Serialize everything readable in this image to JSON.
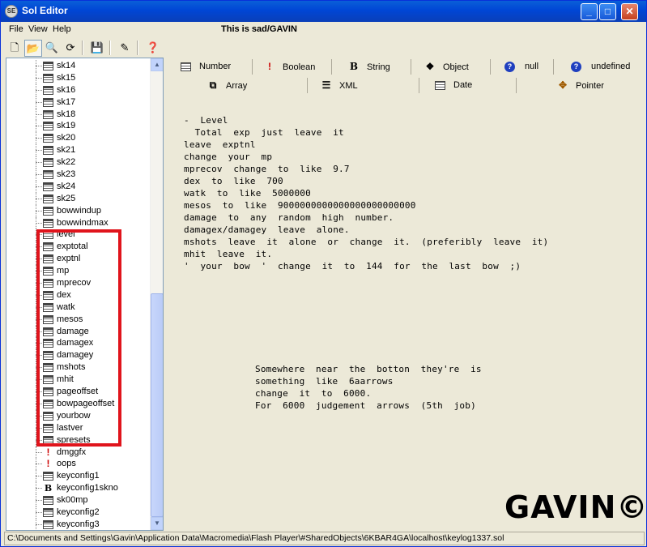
{
  "window": {
    "title": "Sol Editor",
    "app_icon_text": "SE"
  },
  "menu": {
    "file": "File",
    "view": "View",
    "help": "Help"
  },
  "header_caption": "This is sad/GAVIN",
  "toolbar": {
    "icons": [
      "new-icon",
      "open-folder-icon",
      "find-icon",
      "refresh-icon",
      "save-icon",
      "wand-icon",
      "help-icon"
    ]
  },
  "tree": {
    "items": [
      {
        "label": "sk14",
        "type": "number"
      },
      {
        "label": "sk15",
        "type": "number"
      },
      {
        "label": "sk16",
        "type": "number"
      },
      {
        "label": "sk17",
        "type": "number"
      },
      {
        "label": "sk18",
        "type": "number"
      },
      {
        "label": "sk19",
        "type": "number"
      },
      {
        "label": "sk20",
        "type": "number"
      },
      {
        "label": "sk21",
        "type": "number"
      },
      {
        "label": "sk22",
        "type": "number"
      },
      {
        "label": "sk23",
        "type": "number"
      },
      {
        "label": "sk24",
        "type": "number"
      },
      {
        "label": "sk25",
        "type": "number"
      },
      {
        "label": "bowwindup",
        "type": "number"
      },
      {
        "label": "bowwindmax",
        "type": "number"
      },
      {
        "label": "level",
        "type": "number"
      },
      {
        "label": "exptotal",
        "type": "number"
      },
      {
        "label": "exptnl",
        "type": "number"
      },
      {
        "label": "mp",
        "type": "number"
      },
      {
        "label": "mprecov",
        "type": "number"
      },
      {
        "label": "dex",
        "type": "number"
      },
      {
        "label": "watk",
        "type": "number"
      },
      {
        "label": "mesos",
        "type": "number"
      },
      {
        "label": "damage",
        "type": "number"
      },
      {
        "label": "damagex",
        "type": "number"
      },
      {
        "label": "damagey",
        "type": "number"
      },
      {
        "label": "mshots",
        "type": "number"
      },
      {
        "label": "mhit",
        "type": "number"
      },
      {
        "label": "pageoffset",
        "type": "number"
      },
      {
        "label": "bowpageoffset",
        "type": "number"
      },
      {
        "label": "yourbow",
        "type": "number"
      },
      {
        "label": "lastver",
        "type": "number"
      },
      {
        "label": "spresets",
        "type": "number"
      },
      {
        "label": "dmggfx",
        "type": "boolean"
      },
      {
        "label": "oops",
        "type": "boolean"
      },
      {
        "label": "keyconfig1",
        "type": "number"
      },
      {
        "label": "keyconfig1skno",
        "type": "string"
      },
      {
        "label": "sk00mp",
        "type": "number"
      },
      {
        "label": "keyconfig2",
        "type": "number"
      },
      {
        "label": "keyconfig3",
        "type": "number"
      }
    ]
  },
  "tabs": {
    "row1": [
      {
        "label": "Number",
        "icon": "grid-icon"
      },
      {
        "label": "Boolean",
        "icon": "exclamation-icon"
      },
      {
        "label": "String",
        "icon": "bold-b-icon"
      },
      {
        "label": "Object",
        "icon": "object-icon"
      },
      {
        "label": "null",
        "icon": "question-icon"
      },
      {
        "label": "undefined",
        "icon": "question-icon"
      }
    ],
    "row2": [
      {
        "label": "Array",
        "icon": "array-icon"
      },
      {
        "label": "XML",
        "icon": "list-icon"
      },
      {
        "label": "Date",
        "icon": "calendar-icon"
      },
      {
        "label": "Pointer",
        "icon": "pointer-icon"
      }
    ]
  },
  "notes": {
    "main": "-  Level\n  Total  exp  just  leave  it\nleave  exptnl\nchange  your  mp\nmprecov  change  to  like  9.7\ndex  to  like  700\nwatk  to  like  5000000\nmesos  to  like  9000000000000000000000000\ndamage  to  any  random  high  number.\ndamagex/damagey  leave  alone.\nmshots  leave  it  alone  or  change  it.  (preferibly  leave  it)\nmhit  leave  it.\n'  your  bow  '  change  it  to  144  for  the  last  bow  ;)",
    "secondary": "Somewhere  near  the  botton  they're  is\nsomething  like  6aarrows\nchange  it  to  6000.\nFor  6000  judgement  arrows  (5th  job)"
  },
  "logo_text": "GAVIN©",
  "status_path": "C:\\Documents and Settings\\Gavin\\Application Data\\Macromedia\\Flash Player\\#SharedObjects\\6KBAR4GA\\localhost\\keylog1337.sol"
}
